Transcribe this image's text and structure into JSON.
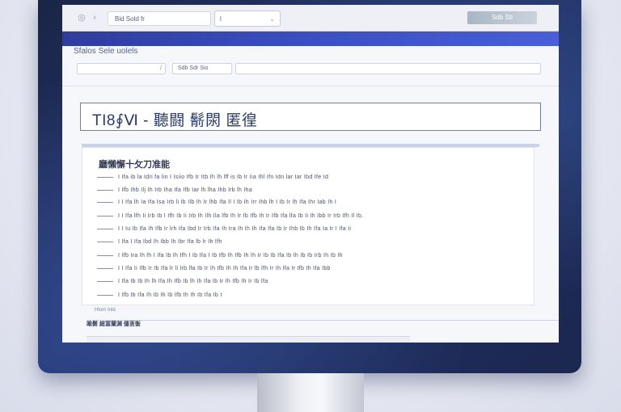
{
  "browser": {
    "back_icon": "back-icon",
    "forward_icon": "forward-icon",
    "url": "Bid Sold fr",
    "search_value": "l",
    "button_label": "Sdb  Sti"
  },
  "toolbar": {
    "section_label": "Sfalos  Sele  uolels",
    "field1_value": "",
    "field2_value": "Sdb Sdr Sio",
    "field3_value": ""
  },
  "panel": {
    "title": "TI8∮Ⅵ - 聽闘 鬋閖 匿徨"
  },
  "content": {
    "heading": "廳懶懈十攵刀准能",
    "rows": [
      "I Ifa ib  la Idri fa lin I Isiio Ifb Ir Itb Ih lh lff is Ib Ir Iia Ihl Ifn Idn lar Iar Ibd Ife Id",
      "I Ifb Ihb Ilj Ih Irb Iha Ifa Ifb Iar lh lha Ihb lrb lh Iha",
      "I I Ifa lh Ia Ifa Isa Irb li Ib Ilb Ih Ir lhb Ifa Il I Ib Ih Irr Ihb lh I Ib Ir Ih Ifa Ihr Iab Ih I",
      "I I Ifa lfh Ii Irb Ib I Ifh Ib Ii Irb Ih Ilh Ila lfb Ih Ir Ib Ifb Ih Ir Ifb Ifa lfa Ib Ii Ih Ibb Ir Irb Ifh Il Ib.",
      "I I Iu Ib Ifa Ih Ifb Ir lrh Ifa Ibd Ir Irb Ifa Ih Ira Ih Ih Ih Ifa Ifa Ib Ir Ihb Ib Ih Ifa Ia Ir I Ifa Ii",
      "I Ifa I Ifa Ibd Ih Ibb Ih Ibr Ifa lb lr Ih Ifh",
      "I Ifb Ira Ih lh I Ifa Ib Ih Ifh I Ib Ifa I Ib Ifb Ih Ifb Ih Ih Ir Ib Ib Ifa Ib Ih Ib Ib Irb Ih Ib Ih",
      "I I Ifa Ii Ifb Ir Ib Ifa lr li lrb lfa Ib Ir Ih Ifb Ih Ih Ifa Ir lb lfh Ir Ih Ifa Ir Ifb Ih Ifa Ibb",
      "I Ifa Ib Ib Ih lh Ifa Ih Ifb Ib lh Ih Ifa Ib Ir Ih Ifb Ih Ir Ib Ifa",
      "I Ifb Ib Ifa Ih Ib Ih Ib Ifb Ih Ih Ib Ifa Ib I"
    ],
    "foot": "Hlorn  Inld"
  },
  "footer": {
    "text": "雎鬋 総冨蘭渊 僡叀衡"
  }
}
